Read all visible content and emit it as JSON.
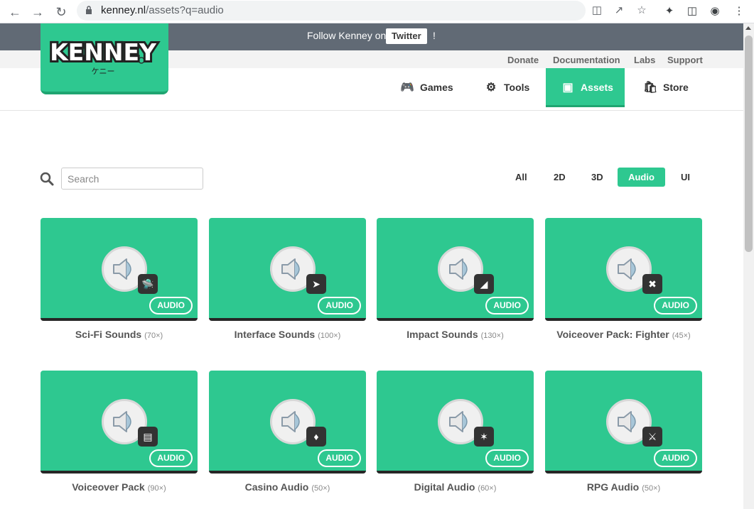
{
  "browser": {
    "url_host": "kenney.nl",
    "url_path": "/assets?q=audio"
  },
  "banner": {
    "follow_text": "Follow Kenney on",
    "twitter_label": "Twitter",
    "bang": "!"
  },
  "logo": {
    "text": "KENNEY",
    "sub": "ケニー"
  },
  "sub_links": [
    "Donate",
    "Documentation",
    "Labs",
    "Support"
  ],
  "nav": {
    "games": "Games",
    "tools": "Tools",
    "assets": "Assets",
    "store": "Store"
  },
  "search": {
    "placeholder": "Search"
  },
  "filters": [
    "All",
    "2D",
    "3D",
    "Audio",
    "UI"
  ],
  "active_filter": "Audio",
  "colors": {
    "accent": "#2ec890",
    "banner": "#616a75"
  },
  "cards": [
    {
      "title": "Sci-Fi Sounds",
      "count": "(70×)",
      "tag": "AUDIO",
      "icon": "ufo-icon"
    },
    {
      "title": "Interface Sounds",
      "count": "(100×)",
      "tag": "AUDIO",
      "icon": "cursor-icon"
    },
    {
      "title": "Impact Sounds",
      "count": "(130×)",
      "tag": "AUDIO",
      "icon": "impact-icon"
    },
    {
      "title": "Voiceover Pack: Fighter",
      "count": "(45×)",
      "tag": "AUDIO",
      "icon": "cross-icon"
    },
    {
      "title": "Voiceover Pack",
      "count": "(90×)",
      "tag": "AUDIO",
      "icon": "speech-bubble-icon"
    },
    {
      "title": "Casino Audio",
      "count": "(50×)",
      "tag": "AUDIO",
      "icon": "playing-card-icon"
    },
    {
      "title": "Digital Audio",
      "count": "(60×)",
      "tag": "AUDIO",
      "icon": "star-ticket-icon"
    },
    {
      "title": "RPG Audio",
      "count": "(50×)",
      "tag": "AUDIO",
      "icon": "crossed-swords-icon"
    }
  ]
}
